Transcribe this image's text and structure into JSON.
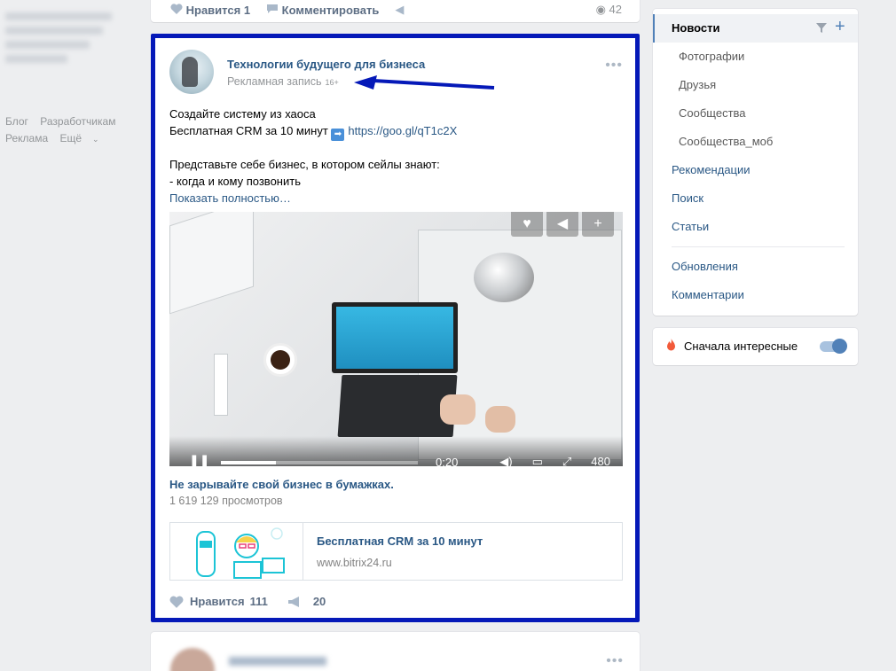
{
  "left": {
    "links": [
      "Блог",
      "Разработчикам",
      "Реклама",
      "Ещё"
    ]
  },
  "top_post": {
    "like_label": "Нравится",
    "like_count": "1",
    "comment_label": "Комментировать",
    "views": "42"
  },
  "post": {
    "author": "Технологии будущего для бизнеса",
    "subtitle": "Рекламная запись",
    "age_badge": "16+",
    "text_line1": "Создайте систему из хаоса",
    "text_line2": "Бесплатная CRM за 10 минут",
    "text_link": "https://goo.gl/qT1c2X",
    "text_line3": "Представьте себе бизнес, в котором сейлы знают:",
    "text_line4": "- когда и кому позвонить",
    "show_more": "Показать полностью…",
    "video": {
      "time": "0:20",
      "quality": "480",
      "progress": 0.28
    },
    "video_title": "Не зарывайте свой бизнес в бумажках.",
    "video_views": "1 619 129 просмотров",
    "ad_title": "Бесплатная CRM за 10 минут",
    "ad_url": "www.bitrix24.ru",
    "like_label": "Нравится",
    "like_count": "111",
    "share_count": "20"
  },
  "menu": {
    "active": "Новости",
    "sub_items": [
      "Фотографии",
      "Друзья",
      "Сообщества",
      "Сообщества_моб"
    ],
    "items": [
      "Рекомендации",
      "Поиск",
      "Статьи"
    ],
    "items2": [
      "Обновления",
      "Комментарии"
    ]
  },
  "toggle": {
    "label": "Сначала интересные",
    "enabled": true
  },
  "colors": {
    "accent": "#5181b8",
    "link": "#2a5885",
    "highlight_border": "#0519b8"
  }
}
